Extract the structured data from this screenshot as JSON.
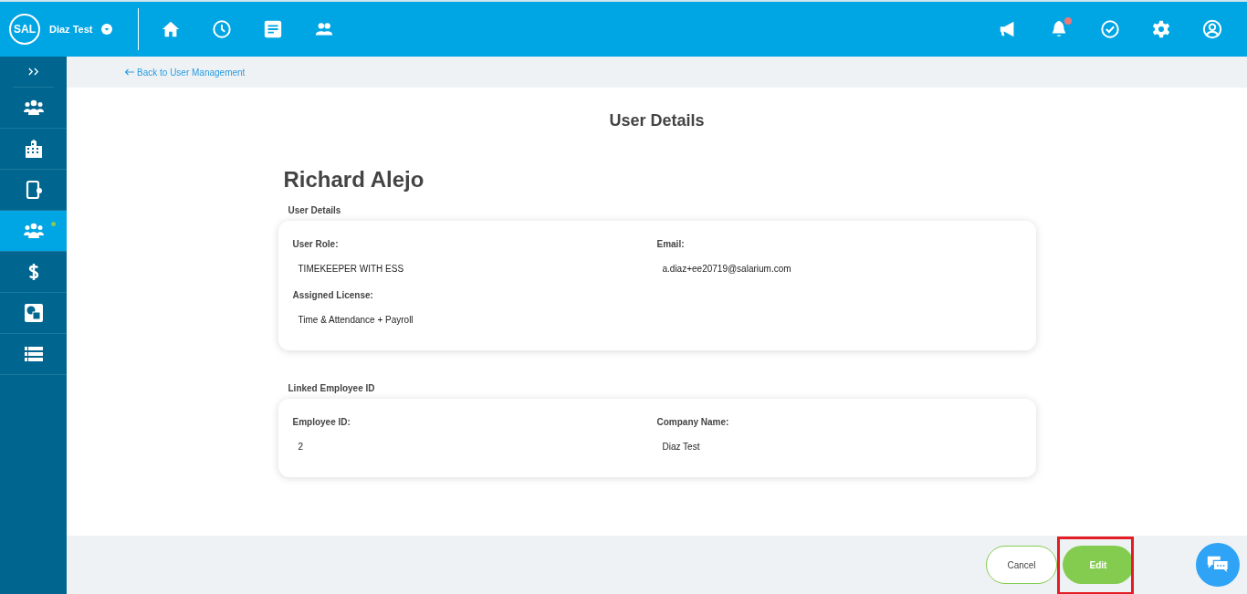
{
  "header": {
    "logo": "SAL",
    "company": "Diaz Test",
    "bell_notification": true
  },
  "sidebar": {
    "items": [
      {
        "selected": false,
        "notification": false
      },
      {
        "selected": false,
        "notification": false
      },
      {
        "selected": false,
        "notification": false
      },
      {
        "selected": true,
        "notification": true
      },
      {
        "selected": false,
        "notification": false
      },
      {
        "selected": false,
        "notification": false
      },
      {
        "selected": false,
        "notification": false
      }
    ]
  },
  "back_link": "Back to User Management",
  "page_title": "User Details",
  "user_name": "Richard Alejo",
  "sections": [
    {
      "title": "User Details",
      "fields": [
        {
          "label": "User Role:",
          "value": "TIMEKEEPER WITH ESS"
        },
        {
          "label": "Email:",
          "value": "a.diaz+ee20719@salarium.com"
        },
        {
          "label": "Assigned License:",
          "value": "Time & Attendance + Payroll"
        }
      ]
    },
    {
      "title": "Linked Employee ID",
      "fields": [
        {
          "label": "Employee ID:",
          "value": "2"
        },
        {
          "label": "Company Name:",
          "value": "Diaz Test"
        }
      ]
    }
  ],
  "buttons": [
    {
      "label": "Cancel",
      "kind": "outline",
      "highlighted": false
    },
    {
      "label": "Edit",
      "kind": "primary",
      "highlighted": true
    }
  ]
}
